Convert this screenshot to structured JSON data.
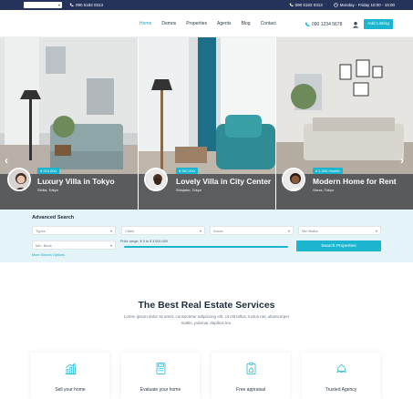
{
  "topbar": {
    "language": "",
    "phone": "090 5182 0313",
    "phone2": "090 5182 0313",
    "hours": "Monday - Friday 10:00 - 18:00"
  },
  "nav": {
    "menu": [
      "Home",
      "Demos",
      "Properties",
      "Agents",
      "Blog",
      "Contact"
    ],
    "active": "Home",
    "phone": "090 1234 5678",
    "add_listing": "Add Listing"
  },
  "slides": [
    {
      "price": "¥ 210,000",
      "title": "Luxury Villa in Tokyo",
      "location": "Shiba, Tokyo"
    },
    {
      "price": "¥ 267,000",
      "title": "Lovely Villa in City Center",
      "location": "Shinjuku, Tokyo"
    },
    {
      "price": "¥ 1,000 /month",
      "title": "Modern Home for Rent",
      "location": "Ginza, Tokyo"
    }
  ],
  "search": {
    "heading": "Advanced Search",
    "types": "Types",
    "cities": "Cities",
    "areas": "Areas",
    "min_baths": "Min Baths",
    "min_beds": "Min. Beds",
    "price_range": "Price range: ¥ 0 to ¥ 3,500,000",
    "button": "Search Properties",
    "more": "More Search Options"
  },
  "services": {
    "title": "The Best Real Estate Services",
    "desc1": "Lorem ipsum dolor sit amet, consectetur adipiscing elit. Ut elit tellus, luctus nec ullamcorper",
    "desc2": "mattis, pulvinar dapibus leo.",
    "cards": [
      "Sell your home",
      "Evaluate your home",
      "Free appraisal",
      "Trusted Agency"
    ]
  },
  "colors": {
    "accent": "#1bb5d0",
    "topbar": "#25325a"
  }
}
